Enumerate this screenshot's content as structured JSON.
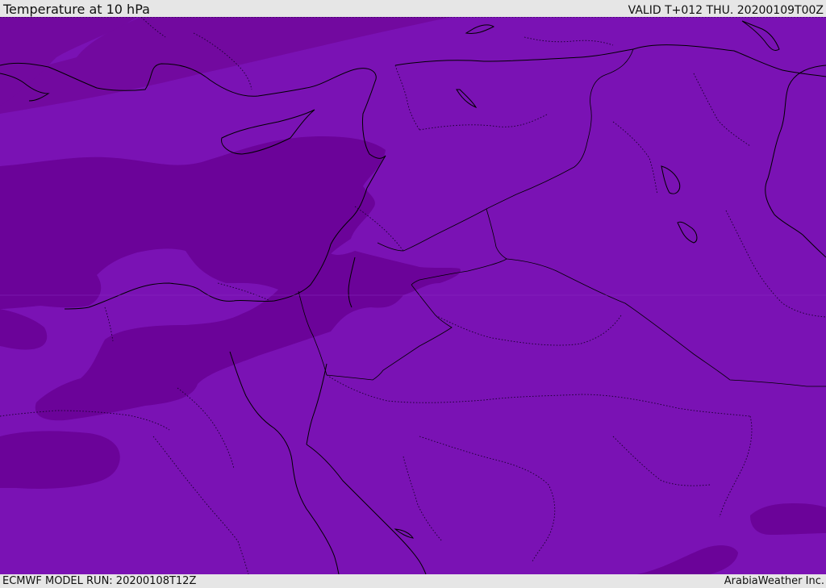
{
  "header": {
    "title": "Temperature at 10 hPa",
    "valid": "VALID T+012 THU. 20200109T00Z"
  },
  "footer": {
    "model_run": "ECMWF MODEL RUN: 20200108T12Z",
    "credit": "ArabiaWeather Inc."
  },
  "colors": {
    "field_base": "#7a12b4",
    "field_cold": "#6b0399",
    "field_band": "#72099f",
    "coastline": "#000000",
    "frame": "#e6e6e6"
  },
  "icons": [
    "map-canvas"
  ]
}
